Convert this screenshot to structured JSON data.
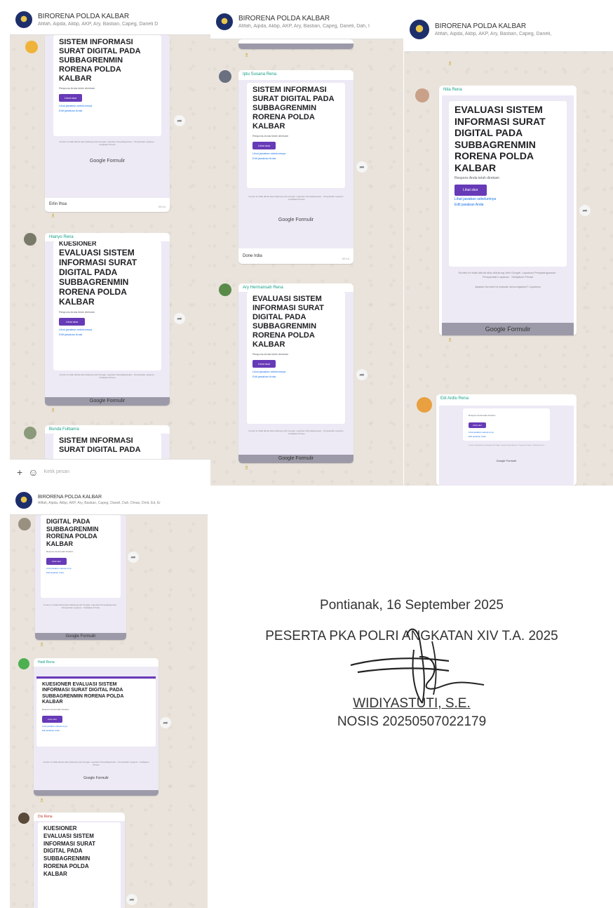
{
  "group": {
    "name": "BIRORENA POLDA KALBAR",
    "members_a": "Afifah, Aipda, Akbp, AKP, Ary, Bastian, Capeg, Daneli D",
    "members_b": "Afifah, Aipda, Akbp, AKP, Ary, Bastian, Capeg, Daneli, Dah, I",
    "members_c": "Afifah, Aipda, Akbp, AKP, Ary, Bastian, Capeg, Daneli,",
    "members_d": "Afifah, Aipda, Akbp, AKP, Ary, Bastian, Capeg, Daneli, Dah, Dmas, Dmit, Ed, Er"
  },
  "form": {
    "title_short": "SISTEM INFORMASI\nSURAT DIGITAL PADA\nSUBBAGRENMIN\nRORENA POLDA\nKALBAR",
    "title_eval": "EVALUASI SISTEM\nINFORMASI SURAT\nDIGITAL PADA\nSUBBAGRENMIN\nRORENA POLDA\nKALBAR",
    "title_kues_partial": "KUESIONER",
    "title_partial_top": "DIGITAL PADA\nSUBBAGRENMIN\nRORENA POLDA\nKALBAR",
    "title_wide": "KUESIONER EVALUASI SISTEM\nINFORMASI SURAT DIGITAL PADA\nSUBBAGRENMIN RORENA POLDA\nKALBAR",
    "title_narrow": "KUESIONER\nEVALUASI SISTEM\nINFORMASI SURAT\nDIGITAL PADA\nSUBBAGRENMIN\nRORENA POLDA\nKALBAR",
    "title_cut": "SISTEM INFORMASI\nSURAT DIGITAL PADA",
    "response": "Respons Anda telah direkam",
    "button": "Lihat skor",
    "link1": "Lihat jawaban sebelumnya",
    "link2": "Edit jawaban Anda",
    "footer1": "Konten ini tidak dibuat atau didukung oleh Google. Laporkan Penyalahgunaan · Persyaratan Layanan · Kebijakan Privasi",
    "footer2": "Apakah formulir ini tampak mencurigakan? Laporkan",
    "brand": "Google Formulir"
  },
  "messages": {
    "caption_erlin": "Erlin Ihsa",
    "caption_done": "Done Irdia",
    "time": "09.14"
  },
  "senders": {
    "s1": "Hianyo Rena",
    "s2": "Bunda Fulbanra",
    "s3": "Iptu Susana Rena",
    "s4": "Ary Hermansah Rena",
    "s5": "Nita Rena",
    "s6": "Edi Ardlu Rena",
    "s7": "Hadi Rena",
    "s8": "Dis Rena"
  },
  "input": {
    "placeholder": "Ketik pesan"
  },
  "signature": {
    "place_date": "Pontianak, 16 September 2025",
    "role": "PESERTA PKA POLRI ANGKATAN XIV T.A. 2025",
    "name": "WIDIYASTUTI, S.E.",
    "nosis": "NOSIS 20250507022179"
  },
  "colors": {
    "form_purple": "#673ab7",
    "form_bg": "#ede9f5",
    "chat_bg": "#e9e3db",
    "sender_teal": "#16a085"
  }
}
